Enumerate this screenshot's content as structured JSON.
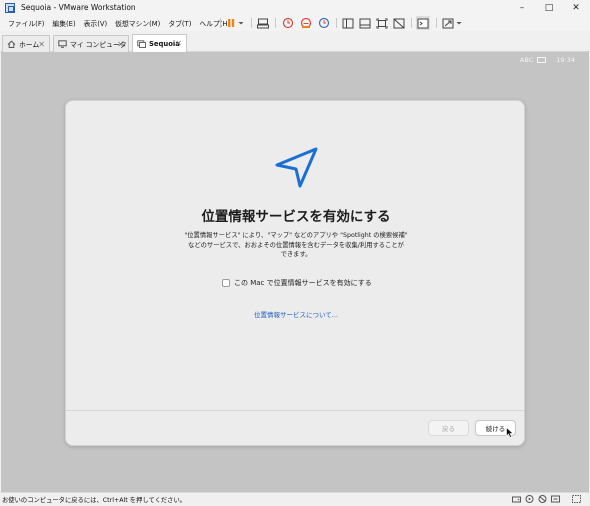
{
  "window": {
    "title": "Sequoia - VMware Workstation",
    "minimize": "–",
    "maximize": "□",
    "close": "✕"
  },
  "menu": {
    "items": [
      "ファイル(F)",
      "編集(E)",
      "表示(V)",
      "仮想マシン(M)",
      "タブ(T)",
      "ヘルプ(H)"
    ]
  },
  "tabs": [
    {
      "label": "ホーム",
      "icon": "home-icon"
    },
    {
      "label": "マイ コンピュータ",
      "icon": "monitor-icon"
    },
    {
      "label": "Sequoia",
      "icon": "vm-icon"
    }
  ],
  "vm_status": {
    "input": "ABC",
    "time": "19:34"
  },
  "dialog": {
    "heading": "位置情報サービスを有効にする",
    "description_line1": "\"位置情報サービス\" により、\"マップ\" などのアプリや \"Spotlight の検索候補\"",
    "description_line2": "などのサービスで、おおよその位置情報を含むデータを収集/利用することが",
    "description_line3": "できます。",
    "checkbox_label": "この Mac で位置情報サービスを有効にする",
    "link": "位置情報サービスについて...",
    "back_button": "戻る",
    "continue_button": "続ける"
  },
  "status": {
    "text": "お使いのコンピュータに戻るには、Ctrl+Alt を押してください。"
  },
  "colors": {
    "accent": "#1a5fc7",
    "pause": "#e8861a",
    "clock": "#d9463b",
    "vm_bg": "#c4c4c4"
  }
}
